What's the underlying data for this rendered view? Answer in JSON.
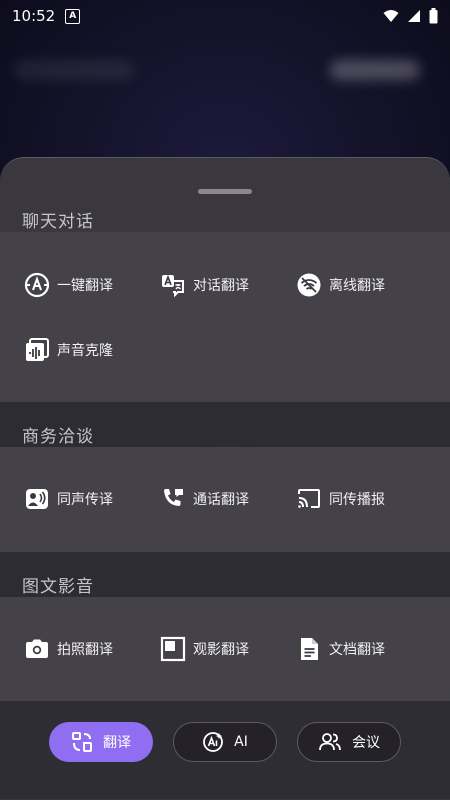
{
  "status_bar": {
    "time": "10:52",
    "notification_badge": "A"
  },
  "sheet": {
    "sections": [
      {
        "title": "聊天对话",
        "items": [
          {
            "label": "一键翻译",
            "icon": "translate-circle-icon"
          },
          {
            "label": "对话翻译",
            "icon": "dialog-translate-icon"
          },
          {
            "label": "离线翻译",
            "icon": "offline-wifi-icon"
          },
          {
            "label": "声音克隆",
            "icon": "voice-clone-icon"
          }
        ]
      },
      {
        "title": "商务洽谈",
        "items": [
          {
            "label": "同声传译",
            "icon": "simultaneous-icon"
          },
          {
            "label": "通话翻译",
            "icon": "phone-call-icon"
          },
          {
            "label": "同传播报",
            "icon": "cast-icon"
          }
        ]
      },
      {
        "title": "图文影音",
        "items": [
          {
            "label": "拍照翻译",
            "icon": "camera-icon"
          },
          {
            "label": "观影翻译",
            "icon": "video-window-icon"
          },
          {
            "label": "文档翻译",
            "icon": "document-icon"
          }
        ]
      }
    ]
  },
  "tabs": {
    "translate": "翻译",
    "ai": "AI",
    "meeting": "会议"
  },
  "colors": {
    "accent": "#8f6ef2",
    "sheet": "#3a383e"
  }
}
